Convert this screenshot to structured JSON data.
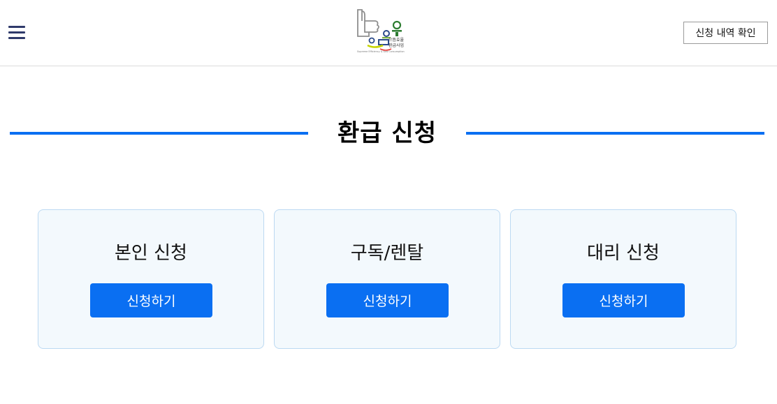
{
  "header": {
    "menu_icon": "hamburger-icon",
    "logo": {
      "line1": "으뜸효율",
      "line2": "환급사업",
      "tagline": "Supreme Efficiency & Low Consumption"
    },
    "history_button_label": "신청 내역 확인"
  },
  "main": {
    "title": "환급 신청",
    "accent_color": "#0a6ff2",
    "cards": [
      {
        "title": "본인 신청",
        "button_label": "신청하기"
      },
      {
        "title": "구독/렌탈",
        "button_label": "신청하기"
      },
      {
        "title": "대리 신청",
        "button_label": "신청하기"
      }
    ]
  }
}
